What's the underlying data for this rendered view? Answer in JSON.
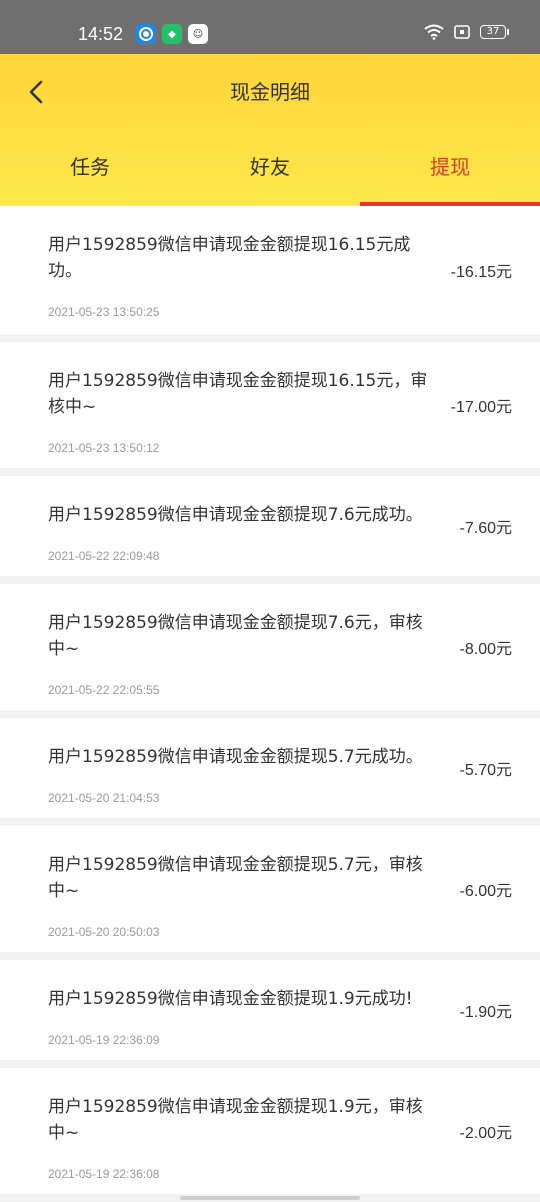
{
  "status_bar": {
    "time": "14:52",
    "battery": "37",
    "icons": [
      "app-icon",
      "app-icon",
      "app-icon",
      "wifi-icon",
      "sim-icon",
      "battery-icon"
    ]
  },
  "header": {
    "title": "现金明细",
    "back_icon": "chevron-left-icon"
  },
  "tabs": [
    {
      "label": "任务"
    },
    {
      "label": "好友"
    },
    {
      "label": "提现"
    }
  ],
  "items": [
    {
      "text": "用户1592859微信申请现金金额提现16.15元成功。",
      "time": "2021-05-23 13:50:25",
      "amount": "-16.15元"
    },
    {
      "text": "用户1592859微信申请现金金额提现16.15元，审核中~",
      "time": "2021-05-23 13:50:12",
      "amount": "-17.00元"
    },
    {
      "text": "用户1592859微信申请现金金额提现7.6元成功。",
      "time": "2021-05-22 22:09:48",
      "amount": "-7.60元"
    },
    {
      "text": "用户1592859微信申请现金金额提现7.6元，审核中~",
      "time": "2021-05-22 22:05:55",
      "amount": "-8.00元"
    },
    {
      "text": "用户1592859微信申请现金金额提现5.7元成功。",
      "time": "2021-05-20 21:04:53",
      "amount": "-5.70元"
    },
    {
      "text": "用户1592859微信申请现金金额提现5.7元，审核中~",
      "time": "2021-05-20 20:50:03",
      "amount": "-6.00元"
    },
    {
      "text": "用户1592859微信申请现金金额提现1.9元成功!",
      "time": "2021-05-19 22:36:09",
      "amount": "-1.90元"
    },
    {
      "text": "用户1592859微信申请现金金额提现1.9元，审核中~",
      "time": "2021-05-19 22:36:08",
      "amount": "-2.00元"
    }
  ],
  "colors": {
    "header_yellow": "#ffd53a",
    "active_red": "#e03a2a",
    "status_gray": "#6f6f6f"
  }
}
